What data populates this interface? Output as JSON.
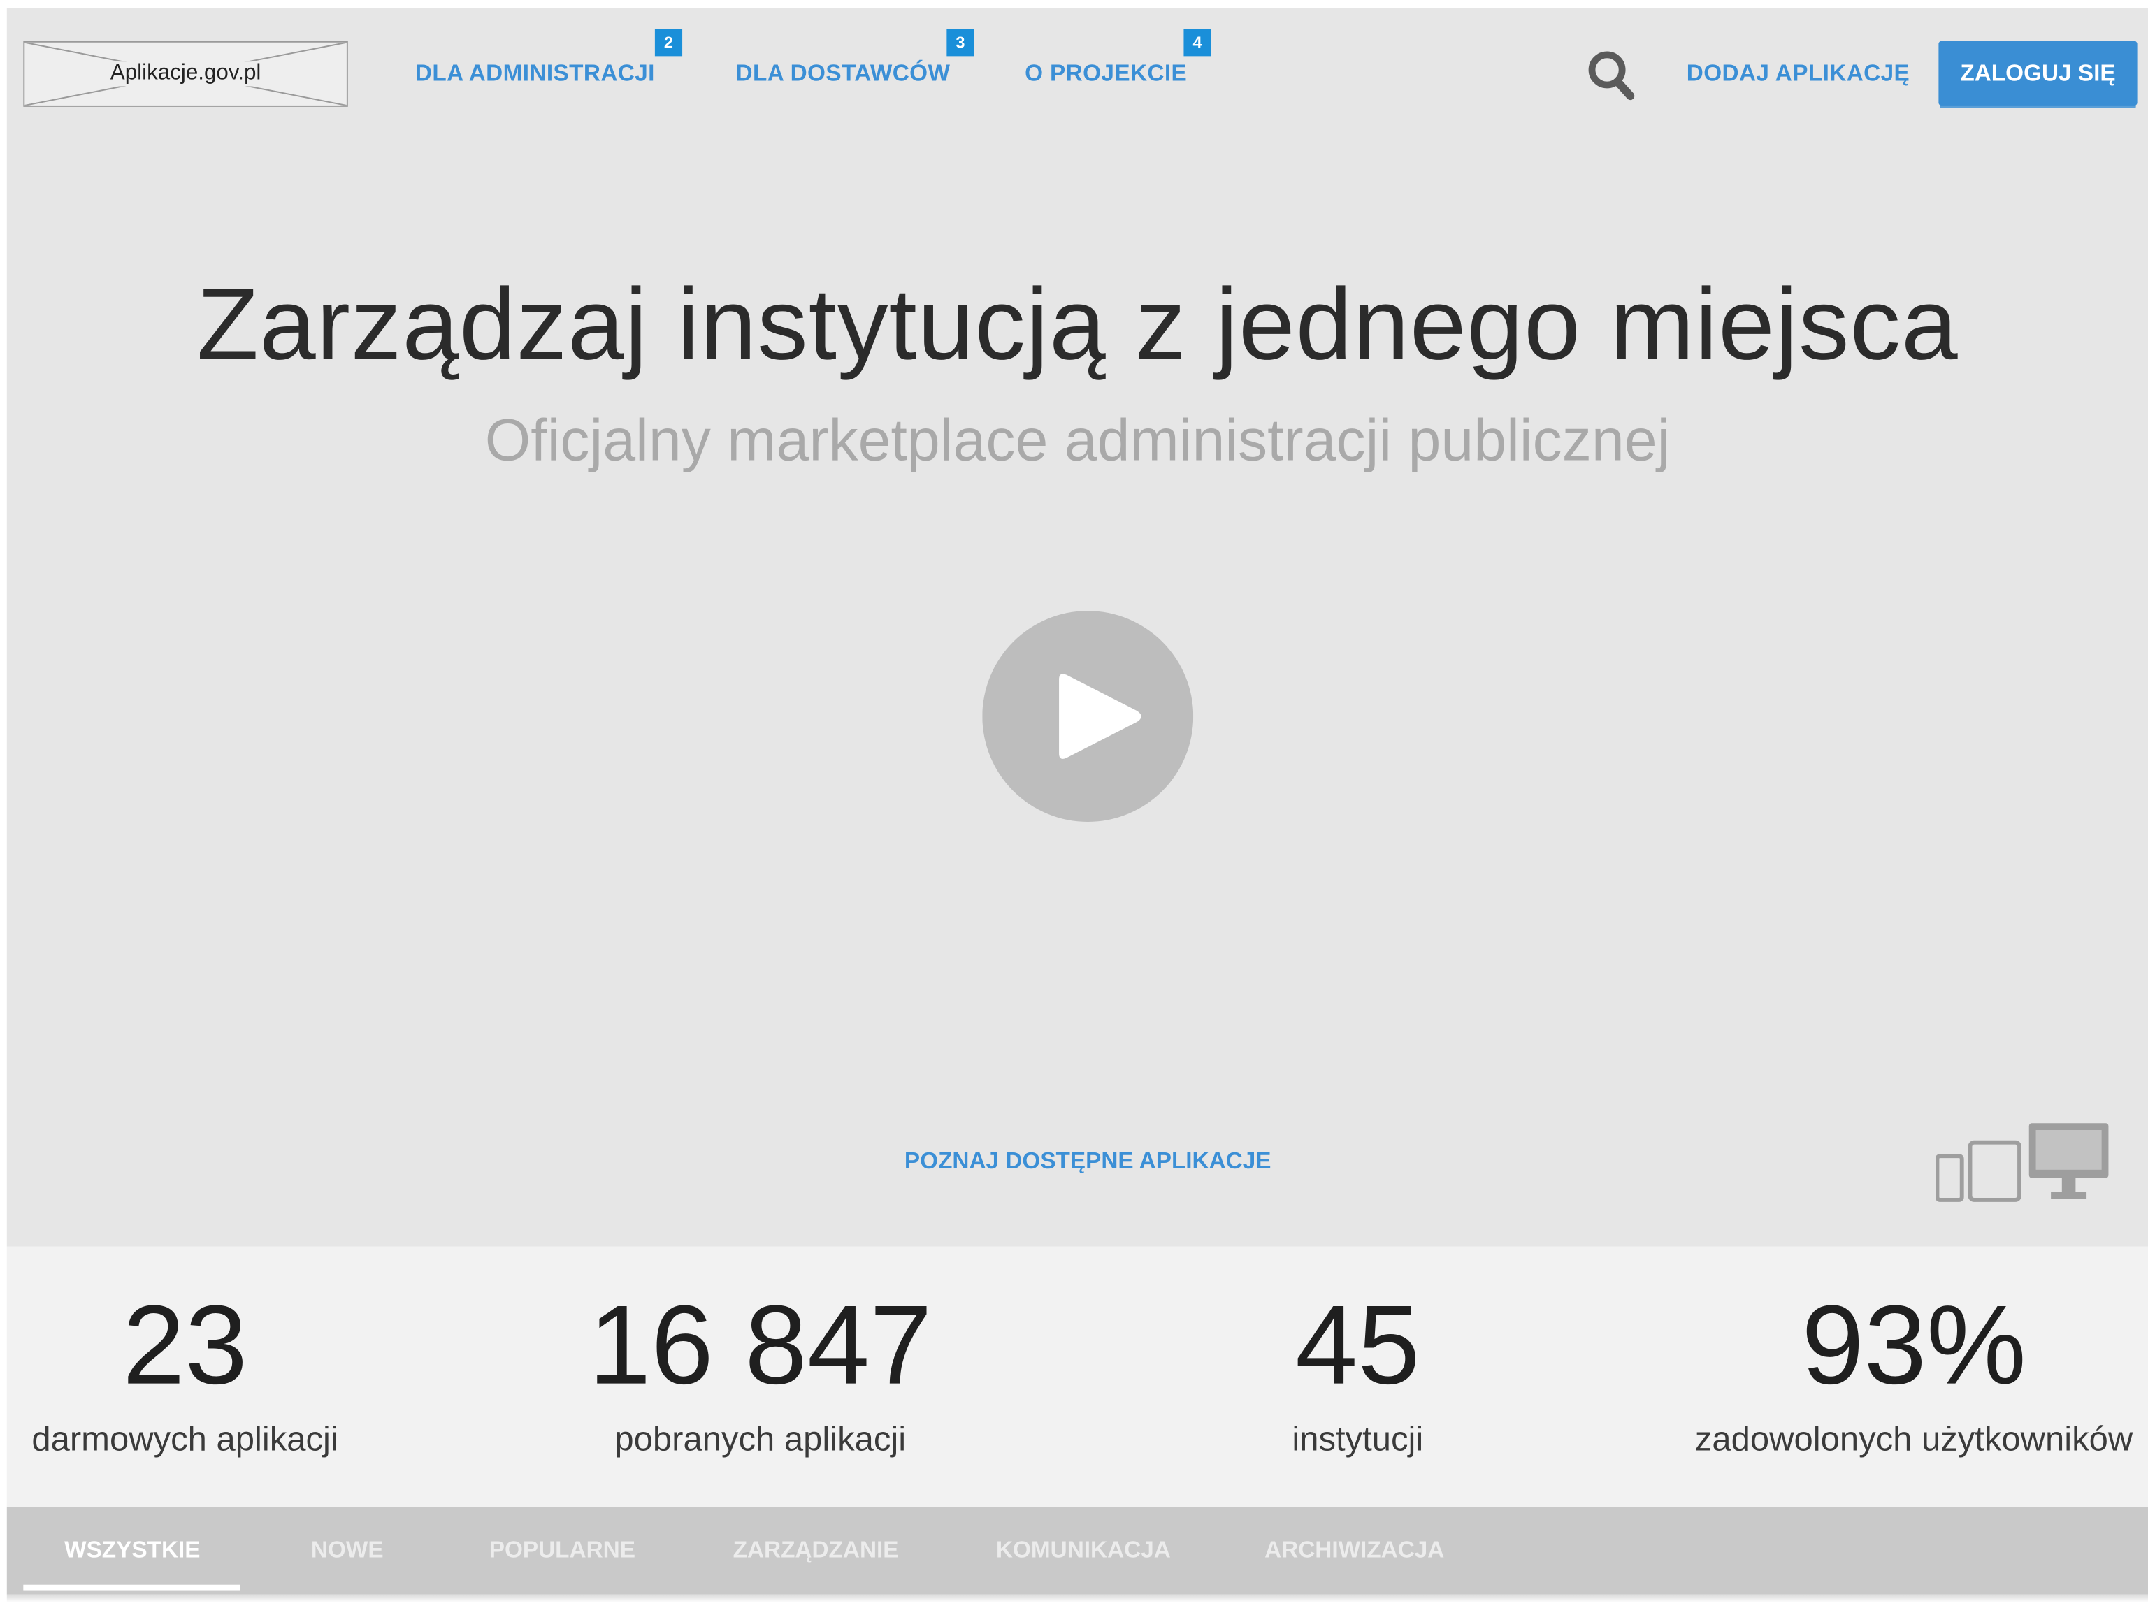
{
  "header": {
    "logo_text": "Aplikacje.gov.pl",
    "nav": [
      {
        "label": "DLA ADMINISTRACJI",
        "badge": "2"
      },
      {
        "label": "DLA DOSTAWCÓW",
        "badge": "3"
      },
      {
        "label": "O PROJEKCIE",
        "badge": "4"
      }
    ],
    "add_app_label": "DODAJ APLIKACJĘ",
    "login_label": "ZALOGUJ SIĘ",
    "search_icon": "search-icon"
  },
  "hero": {
    "title": "Zarządzaj instytucją z jednego miejsca",
    "subtitle": "Oficjalny marketplace administracji publicznej",
    "play_icon": "play-icon",
    "explore_label": "POZNAJ DOSTĘPNE APLIKACJE",
    "devices_icon": "devices-icon"
  },
  "stats": [
    {
      "value": "23",
      "label": "darmowych aplikacji"
    },
    {
      "value": "16 847",
      "label": "pobranych aplikacji"
    },
    {
      "value": "45",
      "label": "instytucji"
    },
    {
      "value": "93%",
      "label": "zadowolonych użytkowników"
    }
  ],
  "tabs": [
    {
      "label": "WSZYSTKIE",
      "active": true
    },
    {
      "label": "NOWE"
    },
    {
      "label": "POPULARNE"
    },
    {
      "label": "ZARZĄDZANIE"
    },
    {
      "label": "KOMUNIKACJA"
    },
    {
      "label": "ARCHIWIZACJA"
    }
  ],
  "colors": {
    "accent": "#3b8fd6",
    "badge": "#1a8fd9",
    "hero_bg": "#e6e6e6",
    "stats_bg": "#f2f2f2",
    "tabs_bg": "#c9c9c9"
  }
}
